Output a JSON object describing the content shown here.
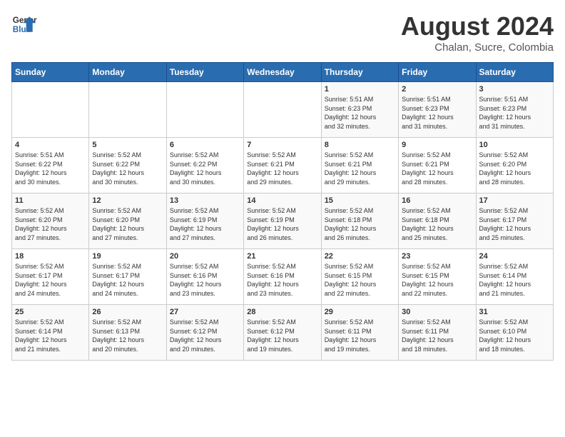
{
  "header": {
    "logo_line1": "General",
    "logo_line2": "Blue",
    "month": "August 2024",
    "location": "Chalan, Sucre, Colombia"
  },
  "weekdays": [
    "Sunday",
    "Monday",
    "Tuesday",
    "Wednesday",
    "Thursday",
    "Friday",
    "Saturday"
  ],
  "weeks": [
    [
      {
        "day": "",
        "content": ""
      },
      {
        "day": "",
        "content": ""
      },
      {
        "day": "",
        "content": ""
      },
      {
        "day": "",
        "content": ""
      },
      {
        "day": "1",
        "content": "Sunrise: 5:51 AM\nSunset: 6:23 PM\nDaylight: 12 hours\nand 32 minutes."
      },
      {
        "day": "2",
        "content": "Sunrise: 5:51 AM\nSunset: 6:23 PM\nDaylight: 12 hours\nand 31 minutes."
      },
      {
        "day": "3",
        "content": "Sunrise: 5:51 AM\nSunset: 6:23 PM\nDaylight: 12 hours\nand 31 minutes."
      }
    ],
    [
      {
        "day": "4",
        "content": "Sunrise: 5:51 AM\nSunset: 6:22 PM\nDaylight: 12 hours\nand 30 minutes."
      },
      {
        "day": "5",
        "content": "Sunrise: 5:52 AM\nSunset: 6:22 PM\nDaylight: 12 hours\nand 30 minutes."
      },
      {
        "day": "6",
        "content": "Sunrise: 5:52 AM\nSunset: 6:22 PM\nDaylight: 12 hours\nand 30 minutes."
      },
      {
        "day": "7",
        "content": "Sunrise: 5:52 AM\nSunset: 6:21 PM\nDaylight: 12 hours\nand 29 minutes."
      },
      {
        "day": "8",
        "content": "Sunrise: 5:52 AM\nSunset: 6:21 PM\nDaylight: 12 hours\nand 29 minutes."
      },
      {
        "day": "9",
        "content": "Sunrise: 5:52 AM\nSunset: 6:21 PM\nDaylight: 12 hours\nand 28 minutes."
      },
      {
        "day": "10",
        "content": "Sunrise: 5:52 AM\nSunset: 6:20 PM\nDaylight: 12 hours\nand 28 minutes."
      }
    ],
    [
      {
        "day": "11",
        "content": "Sunrise: 5:52 AM\nSunset: 6:20 PM\nDaylight: 12 hours\nand 27 minutes."
      },
      {
        "day": "12",
        "content": "Sunrise: 5:52 AM\nSunset: 6:20 PM\nDaylight: 12 hours\nand 27 minutes."
      },
      {
        "day": "13",
        "content": "Sunrise: 5:52 AM\nSunset: 6:19 PM\nDaylight: 12 hours\nand 27 minutes."
      },
      {
        "day": "14",
        "content": "Sunrise: 5:52 AM\nSunset: 6:19 PM\nDaylight: 12 hours\nand 26 minutes."
      },
      {
        "day": "15",
        "content": "Sunrise: 5:52 AM\nSunset: 6:18 PM\nDaylight: 12 hours\nand 26 minutes."
      },
      {
        "day": "16",
        "content": "Sunrise: 5:52 AM\nSunset: 6:18 PM\nDaylight: 12 hours\nand 25 minutes."
      },
      {
        "day": "17",
        "content": "Sunrise: 5:52 AM\nSunset: 6:17 PM\nDaylight: 12 hours\nand 25 minutes."
      }
    ],
    [
      {
        "day": "18",
        "content": "Sunrise: 5:52 AM\nSunset: 6:17 PM\nDaylight: 12 hours\nand 24 minutes."
      },
      {
        "day": "19",
        "content": "Sunrise: 5:52 AM\nSunset: 6:17 PM\nDaylight: 12 hours\nand 24 minutes."
      },
      {
        "day": "20",
        "content": "Sunrise: 5:52 AM\nSunset: 6:16 PM\nDaylight: 12 hours\nand 23 minutes."
      },
      {
        "day": "21",
        "content": "Sunrise: 5:52 AM\nSunset: 6:16 PM\nDaylight: 12 hours\nand 23 minutes."
      },
      {
        "day": "22",
        "content": "Sunrise: 5:52 AM\nSunset: 6:15 PM\nDaylight: 12 hours\nand 22 minutes."
      },
      {
        "day": "23",
        "content": "Sunrise: 5:52 AM\nSunset: 6:15 PM\nDaylight: 12 hours\nand 22 minutes."
      },
      {
        "day": "24",
        "content": "Sunrise: 5:52 AM\nSunset: 6:14 PM\nDaylight: 12 hours\nand 21 minutes."
      }
    ],
    [
      {
        "day": "25",
        "content": "Sunrise: 5:52 AM\nSunset: 6:14 PM\nDaylight: 12 hours\nand 21 minutes."
      },
      {
        "day": "26",
        "content": "Sunrise: 5:52 AM\nSunset: 6:13 PM\nDaylight: 12 hours\nand 20 minutes."
      },
      {
        "day": "27",
        "content": "Sunrise: 5:52 AM\nSunset: 6:12 PM\nDaylight: 12 hours\nand 20 minutes."
      },
      {
        "day": "28",
        "content": "Sunrise: 5:52 AM\nSunset: 6:12 PM\nDaylight: 12 hours\nand 19 minutes."
      },
      {
        "day": "29",
        "content": "Sunrise: 5:52 AM\nSunset: 6:11 PM\nDaylight: 12 hours\nand 19 minutes."
      },
      {
        "day": "30",
        "content": "Sunrise: 5:52 AM\nSunset: 6:11 PM\nDaylight: 12 hours\nand 18 minutes."
      },
      {
        "day": "31",
        "content": "Sunrise: 5:52 AM\nSunset: 6:10 PM\nDaylight: 12 hours\nand 18 minutes."
      }
    ]
  ]
}
